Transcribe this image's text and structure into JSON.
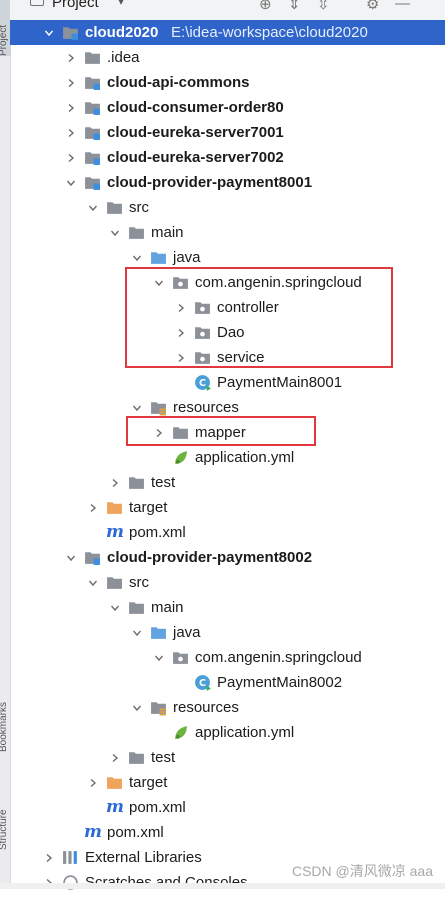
{
  "side_tabs": {
    "project": "Project",
    "bookmarks": "Bookmarks",
    "structure": "Structure"
  },
  "toolbar": {
    "title": "Project"
  },
  "tree": [
    {
      "label": "cloud2020",
      "path": "E:\\idea-workspace\\cloud2020",
      "depth": 0,
      "expanded": true,
      "icon": "module-folder-icon",
      "bold": true,
      "selected": true
    },
    {
      "label": ".idea",
      "depth": 1,
      "expanded": false,
      "icon": "folder-icon"
    },
    {
      "label": "cloud-api-commons",
      "depth": 1,
      "expanded": false,
      "icon": "module-folder-icon",
      "bold": true
    },
    {
      "label": "cloud-consumer-order80",
      "depth": 1,
      "expanded": false,
      "icon": "module-folder-icon",
      "bold": true
    },
    {
      "label": "cloud-eureka-server7001",
      "depth": 1,
      "expanded": false,
      "icon": "module-folder-icon",
      "bold": true
    },
    {
      "label": "cloud-eureka-server7002",
      "depth": 1,
      "expanded": false,
      "icon": "module-folder-icon",
      "bold": true
    },
    {
      "label": "cloud-provider-payment8001",
      "depth": 1,
      "expanded": true,
      "icon": "module-folder-icon",
      "bold": true
    },
    {
      "label": "src",
      "depth": 2,
      "expanded": true,
      "icon": "folder-icon"
    },
    {
      "label": "main",
      "depth": 3,
      "expanded": true,
      "icon": "folder-icon"
    },
    {
      "label": "java",
      "depth": 4,
      "expanded": true,
      "icon": "source-folder-icon"
    },
    {
      "label": "com.angenin.springcloud",
      "depth": 5,
      "expanded": true,
      "icon": "package-icon"
    },
    {
      "label": "controller",
      "depth": 6,
      "expanded": false,
      "icon": "package-icon"
    },
    {
      "label": "Dao",
      "depth": 6,
      "expanded": false,
      "icon": "package-icon"
    },
    {
      "label": "service",
      "depth": 6,
      "expanded": false,
      "icon": "package-icon"
    },
    {
      "label": "PaymentMain8001",
      "depth": 6,
      "icon": "spring-class-icon"
    },
    {
      "label": "resources",
      "depth": 4,
      "expanded": true,
      "icon": "resources-folder-icon"
    },
    {
      "label": "mapper",
      "depth": 5,
      "expanded": false,
      "icon": "folder-icon"
    },
    {
      "label": "application.yml",
      "depth": 5,
      "icon": "yaml-file-icon"
    },
    {
      "label": "test",
      "depth": 3,
      "expanded": false,
      "icon": "folder-icon"
    },
    {
      "label": "target",
      "depth": 2,
      "expanded": false,
      "icon": "excluded-folder-icon"
    },
    {
      "label": "pom.xml",
      "depth": 2,
      "icon": "maven-file-icon"
    },
    {
      "label": "cloud-provider-payment8002",
      "depth": 1,
      "expanded": true,
      "icon": "module-folder-icon",
      "bold": true
    },
    {
      "label": "src",
      "depth": 2,
      "expanded": true,
      "icon": "folder-icon"
    },
    {
      "label": "main",
      "depth": 3,
      "expanded": true,
      "icon": "folder-icon"
    },
    {
      "label": "java",
      "depth": 4,
      "expanded": true,
      "icon": "source-folder-icon"
    },
    {
      "label": "com.angenin.springcloud",
      "depth": 5,
      "expanded": true,
      "icon": "package-icon"
    },
    {
      "label": "PaymentMain8002",
      "depth": 6,
      "icon": "spring-class-icon"
    },
    {
      "label": "resources",
      "depth": 4,
      "expanded": true,
      "icon": "resources-folder-icon"
    },
    {
      "label": "application.yml",
      "depth": 5,
      "icon": "yaml-file-icon"
    },
    {
      "label": "test",
      "depth": 3,
      "expanded": false,
      "icon": "folder-icon"
    },
    {
      "label": "target",
      "depth": 2,
      "expanded": false,
      "icon": "excluded-folder-icon"
    },
    {
      "label": "pom.xml",
      "depth": 2,
      "icon": "maven-file-icon"
    },
    {
      "label": "pom.xml",
      "depth": 1,
      "icon": "maven-file-icon"
    },
    {
      "label": "External Libraries",
      "depth": 0,
      "expanded": false,
      "icon": "library-icon"
    },
    {
      "label": "Scratches and Consoles",
      "depth": 0,
      "expanded": false,
      "icon": "scratches-icon"
    }
  ],
  "watermark": "CSDN @清风微凉 aaa",
  "colors": {
    "selection": "#2f65ca",
    "highlight_box": "#e0383e",
    "folder": "#8c9199",
    "source_folder": "#62a2e0",
    "excluded_folder": "#f0a35c"
  }
}
